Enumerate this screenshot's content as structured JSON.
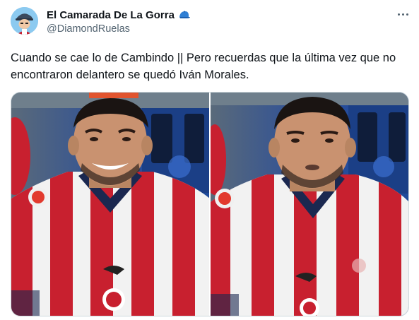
{
  "author": {
    "display_name": "El Camarada De La Gorra",
    "handle": "@DiamondRuelas",
    "avatar_icon": "avatar-illustration",
    "name_emoji_icon": "blue-cap-icon"
  },
  "menu": {
    "icon": "more-options-icon"
  },
  "tweet": {
    "text": "Cuando se cae lo de Cambindo || Pero recuerdas que la última vez que no encontraron delantero se quedó Iván Morales."
  },
  "media": {
    "photos": [
      {
        "description_icon": "photo-smiling-player"
      },
      {
        "description_icon": "photo-serious-player"
      }
    ]
  },
  "colors": {
    "text": "#0f1419",
    "secondary": "#536471",
    "jersey_red": "#c8202f",
    "jersey_white": "#f2f2f2",
    "background_blue": "#1e4a9a",
    "border": "#cfd9de"
  }
}
